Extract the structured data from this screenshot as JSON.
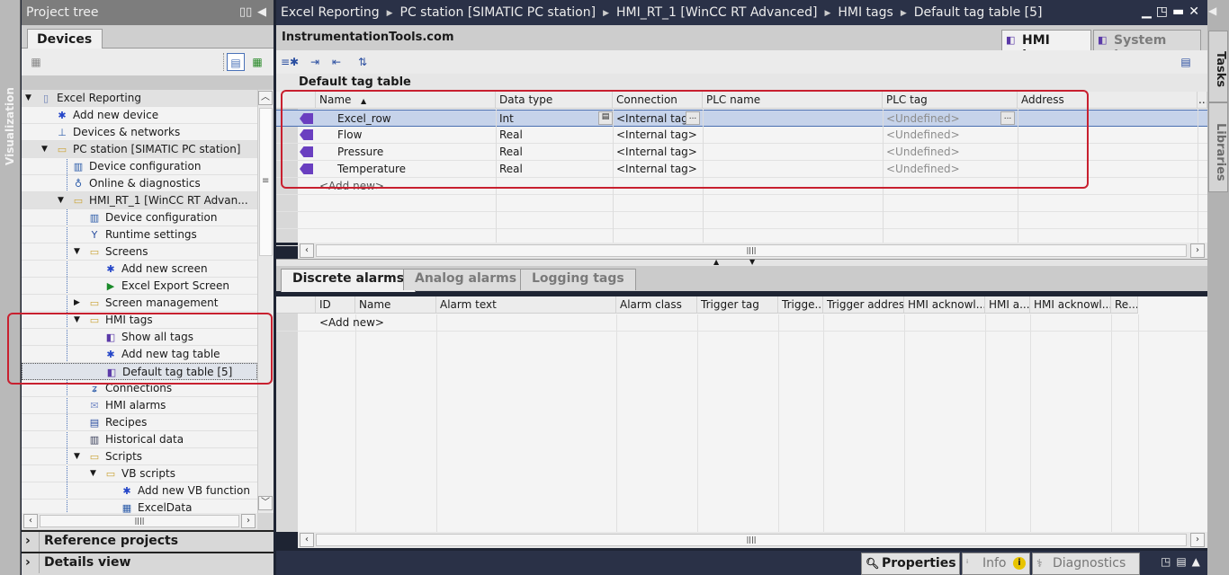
{
  "sidebar_strip": {
    "label": "Visualization"
  },
  "project_tree": {
    "title": "Project tree",
    "tab": "Devices",
    "items": [
      {
        "label": "Excel Reporting",
        "icon": "project-icon",
        "level": 0,
        "expand": "expanded"
      },
      {
        "label": "Add new device",
        "icon": "add-device-icon",
        "level": 1,
        "expand": "none"
      },
      {
        "label": "Devices & networks",
        "icon": "network-icon",
        "level": 1,
        "expand": "none"
      },
      {
        "label": "PC station [SIMATIC PC station]",
        "icon": "pc-station-folder-icon",
        "level": 1,
        "expand": "expanded"
      },
      {
        "label": "Device configuration",
        "icon": "device-config-icon",
        "level": 2,
        "expand": "none"
      },
      {
        "label": "Online & diagnostics",
        "icon": "diagnostics-icon",
        "level": 2,
        "expand": "none"
      },
      {
        "label": "HMI_RT_1 [WinCC RT Advan...",
        "icon": "hmi-folder-icon",
        "level": 2,
        "expand": "expanded"
      },
      {
        "label": "Device configuration",
        "icon": "device-config-icon",
        "level": 3,
        "expand": "none"
      },
      {
        "label": "Runtime settings",
        "icon": "wrench-icon",
        "level": 3,
        "expand": "none"
      },
      {
        "label": "Screens",
        "icon": "folder-icon",
        "level": 3,
        "expand": "expanded"
      },
      {
        "label": "Add new screen",
        "icon": "add-screen-icon",
        "level": 4,
        "expand": "none"
      },
      {
        "label": "Excel Export Screen",
        "icon": "screen-icon",
        "level": 4,
        "expand": "none"
      },
      {
        "label": "Screen management",
        "icon": "folder-icon",
        "level": 3,
        "expand": "collapsed"
      },
      {
        "label": "HMI tags",
        "icon": "tags-folder-icon",
        "level": 3,
        "expand": "expanded"
      },
      {
        "label": "Show all tags",
        "icon": "show-tags-icon",
        "level": 4,
        "expand": "none"
      },
      {
        "label": "Add new tag table",
        "icon": "add-table-icon",
        "level": 4,
        "expand": "none"
      },
      {
        "label": "Default tag table [5]",
        "icon": "tag-table-icon",
        "level": 4,
        "expand": "none"
      },
      {
        "label": "Connections",
        "icon": "connections-icon",
        "level": 3,
        "expand": "none"
      },
      {
        "label": "HMI alarms",
        "icon": "envelope-icon",
        "level": 3,
        "expand": "none"
      },
      {
        "label": "Recipes",
        "icon": "recipes-icon",
        "level": 3,
        "expand": "none"
      },
      {
        "label": "Historical data",
        "icon": "historical-icon",
        "level": 3,
        "expand": "none"
      },
      {
        "label": "Scripts",
        "icon": "folder-icon",
        "level": 3,
        "expand": "expanded"
      },
      {
        "label": "VB scripts",
        "icon": "vb-folder-icon",
        "level": 4,
        "expand": "expanded"
      },
      {
        "label": "Add new VB function",
        "icon": "add-function-icon",
        "level": 5,
        "expand": "none"
      },
      {
        "label": "ExcelData",
        "icon": "vb-script-icon",
        "level": 5,
        "expand": "none"
      }
    ],
    "reference_projects": "Reference projects",
    "details_view": "Details view"
  },
  "breadcrumb": [
    "Excel Reporting",
    "PC station [SIMATIC PC station]",
    "HMI_RT_1 [WinCC RT Advanced]",
    "HMI tags",
    "Default tag table [5]"
  ],
  "editor": {
    "watermark": "InstrumentationTools.com",
    "tabs": [
      {
        "label": "HMI tags",
        "active": true
      },
      {
        "label": "System tags",
        "active": false
      }
    ],
    "table_title": "Default tag table",
    "columns": [
      "Name",
      "Data type",
      "Connection",
      "PLC name",
      "PLC tag",
      "Address"
    ],
    "rows": [
      {
        "name": "Excel_row",
        "data_type": "Int",
        "connection": "<Internal tag>",
        "plc_name": "",
        "plc_tag": "<Undefined>",
        "address": ""
      },
      {
        "name": "Flow",
        "data_type": "Real",
        "connection": "<Internal tag>",
        "plc_name": "",
        "plc_tag": "<Undefined>",
        "address": ""
      },
      {
        "name": "Pressure",
        "data_type": "Real",
        "connection": "<Internal tag>",
        "plc_name": "",
        "plc_tag": "<Undefined>",
        "address": ""
      },
      {
        "name": "Temperature",
        "data_type": "Real",
        "connection": "<Internal tag>",
        "plc_name": "",
        "plc_tag": "<Undefined>",
        "address": ""
      }
    ],
    "add_new": "<Add new>",
    "ellipsis": "..."
  },
  "alarms": {
    "tabs": [
      {
        "label": "Discrete alarms",
        "active": true
      },
      {
        "label": "Analog alarms",
        "active": false
      },
      {
        "label": "Logging tags",
        "active": false
      }
    ],
    "columns": [
      "ID",
      "Name",
      "Alarm text",
      "Alarm class",
      "Trigger tag",
      "Trigge..",
      "Trigger address",
      "HMI acknowl...",
      "HMI a...",
      "HMI acknowl...",
      "Re..."
    ],
    "add_new": "<Add new>"
  },
  "right_strip": {
    "tasks": "Tasks",
    "libraries": "Libraries"
  },
  "status_tabs": [
    {
      "label": "Properties",
      "icon": "properties-icon"
    },
    {
      "label": "Info",
      "icon": "info-icon"
    },
    {
      "label": "Diagnostics",
      "icon": "diagnostics-icon"
    }
  ],
  "colors": {
    "accent_red": "#c8202f",
    "selection": "#c6d3ea",
    "title_bar": "#2a3147",
    "tag_icon": "#6a3fc0"
  }
}
